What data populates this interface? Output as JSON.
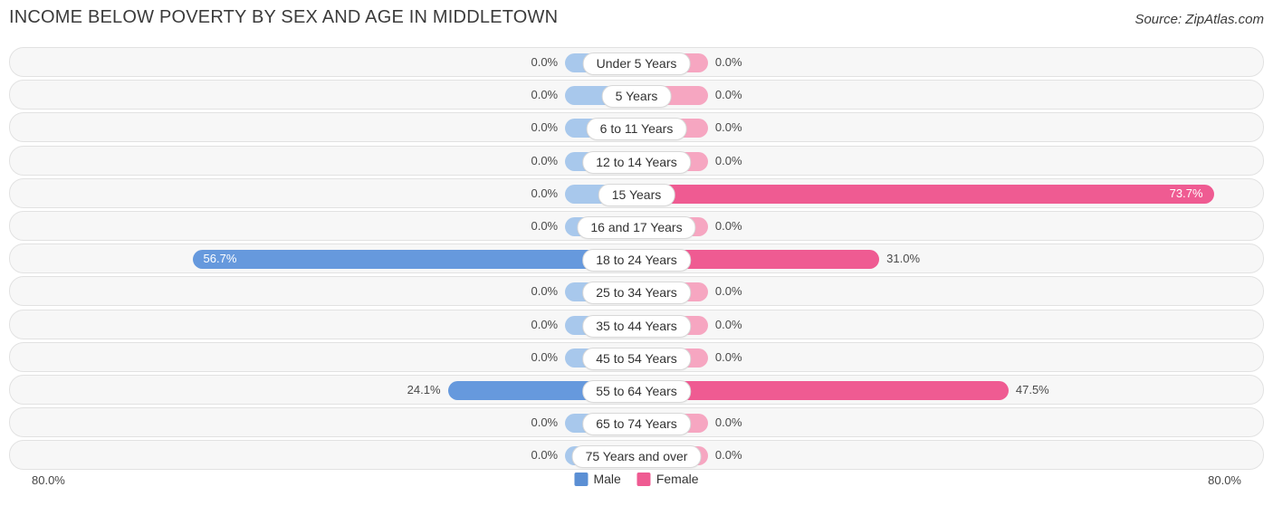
{
  "header": {
    "title": "INCOME BELOW POVERTY BY SEX AND AGE IN MIDDLETOWN",
    "source": "Source: ZipAtlas.com"
  },
  "axis": {
    "left_label": "80.0%",
    "right_label": "80.0%"
  },
  "legend": {
    "male": "Male",
    "female": "Female"
  },
  "colors": {
    "male_light": "#a8c8ec",
    "male_dark": "#6699dd",
    "female_light": "#f6a6c1",
    "female_dark": "#ef5b92",
    "legend_male": "#5b8fd4",
    "legend_female": "#ef5b92"
  },
  "chart_data": {
    "type": "bar",
    "title": "INCOME BELOW POVERTY BY SEX AND AGE IN MIDDLETOWN",
    "xlabel": "",
    "ylabel": "",
    "xlim": [
      0,
      80
    ],
    "grid": false,
    "legend_position": "bottom-center",
    "categories": [
      "Under 5 Years",
      "5 Years",
      "6 to 11 Years",
      "12 to 14 Years",
      "15 Years",
      "16 and 17 Years",
      "18 to 24 Years",
      "25 to 34 Years",
      "35 to 44 Years",
      "45 to 54 Years",
      "55 to 64 Years",
      "65 to 74 Years",
      "75 Years and over"
    ],
    "series": [
      {
        "name": "Male",
        "values": [
          0.0,
          0.0,
          0.0,
          0.0,
          0.0,
          0.0,
          56.7,
          0.0,
          0.0,
          0.0,
          24.1,
          0.0,
          0.0
        ],
        "labels": [
          "0.0%",
          "0.0%",
          "0.0%",
          "0.0%",
          "0.0%",
          "0.0%",
          "56.7%",
          "0.0%",
          "0.0%",
          "0.0%",
          "24.1%",
          "0.0%",
          "0.0%"
        ]
      },
      {
        "name": "Female",
        "values": [
          0.0,
          0.0,
          0.0,
          0.0,
          73.7,
          0.0,
          31.0,
          0.0,
          0.0,
          0.0,
          47.5,
          0.0,
          0.0
        ],
        "labels": [
          "0.0%",
          "0.0%",
          "0.0%",
          "0.0%",
          "73.7%",
          "0.0%",
          "31.0%",
          "0.0%",
          "0.0%",
          "0.0%",
          "47.5%",
          "0.0%",
          "0.0%"
        ]
      }
    ]
  }
}
